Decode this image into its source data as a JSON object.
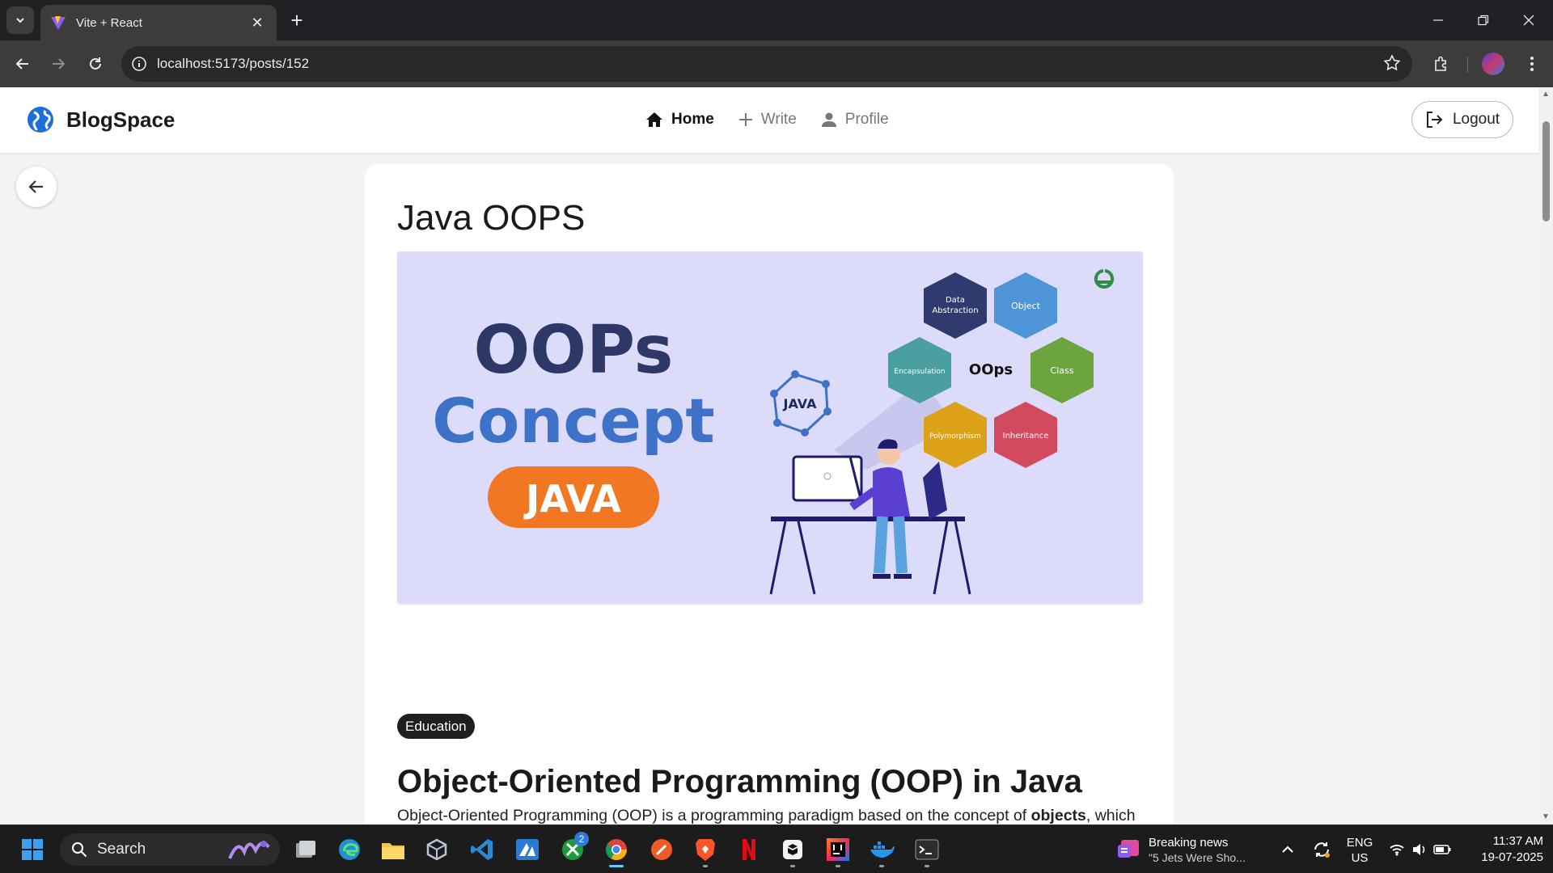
{
  "browser": {
    "tab_title": "Vite + React",
    "url": "localhost:5173/posts/152"
  },
  "app": {
    "brand": "BlogSpace",
    "nav": [
      {
        "label": "Home",
        "icon": "home-icon",
        "active": true
      },
      {
        "label": "Write",
        "icon": "plus-icon",
        "active": false
      },
      {
        "label": "Profile",
        "icon": "person-icon",
        "active": false
      }
    ],
    "logout_label": "Logout"
  },
  "post": {
    "title": "Java OOPS",
    "cover": {
      "headline_1": "OOPs",
      "headline_2": "Concept",
      "badge": "JAVA",
      "center_label": "OOps",
      "hexes": [
        "Data Abstraction",
        "Object",
        "Class",
        "Inheritance",
        "Polymorphism",
        "Encapsulation"
      ],
      "java_mark": "JAVA"
    },
    "category": "Education",
    "heading": "Object-Oriented Programming (OOP) in Java",
    "para_before": "Object-Oriented Programming (OOP) is a programming paradigm based on the concept of ",
    "para_bold": "objects",
    "para_after": ", which can contain data and methods. Java is a pure object-oriented language (except for primitive types)."
  },
  "taskbar": {
    "search_label": "Search",
    "xbox_badge": "2",
    "news_title": "Breaking news",
    "news_sub": "\"5 Jets Were Sho...",
    "lang_1": "ENG",
    "lang_2": "US",
    "time": "11:37 AM",
    "date": "19-07-2025"
  },
  "colors": {
    "accent_blue": "#1e6fd9",
    "cover_bg": "#dcdcfa",
    "navy": "#2e3867",
    "concept_blue": "#3e72c9",
    "java_orange": "#f27722"
  }
}
